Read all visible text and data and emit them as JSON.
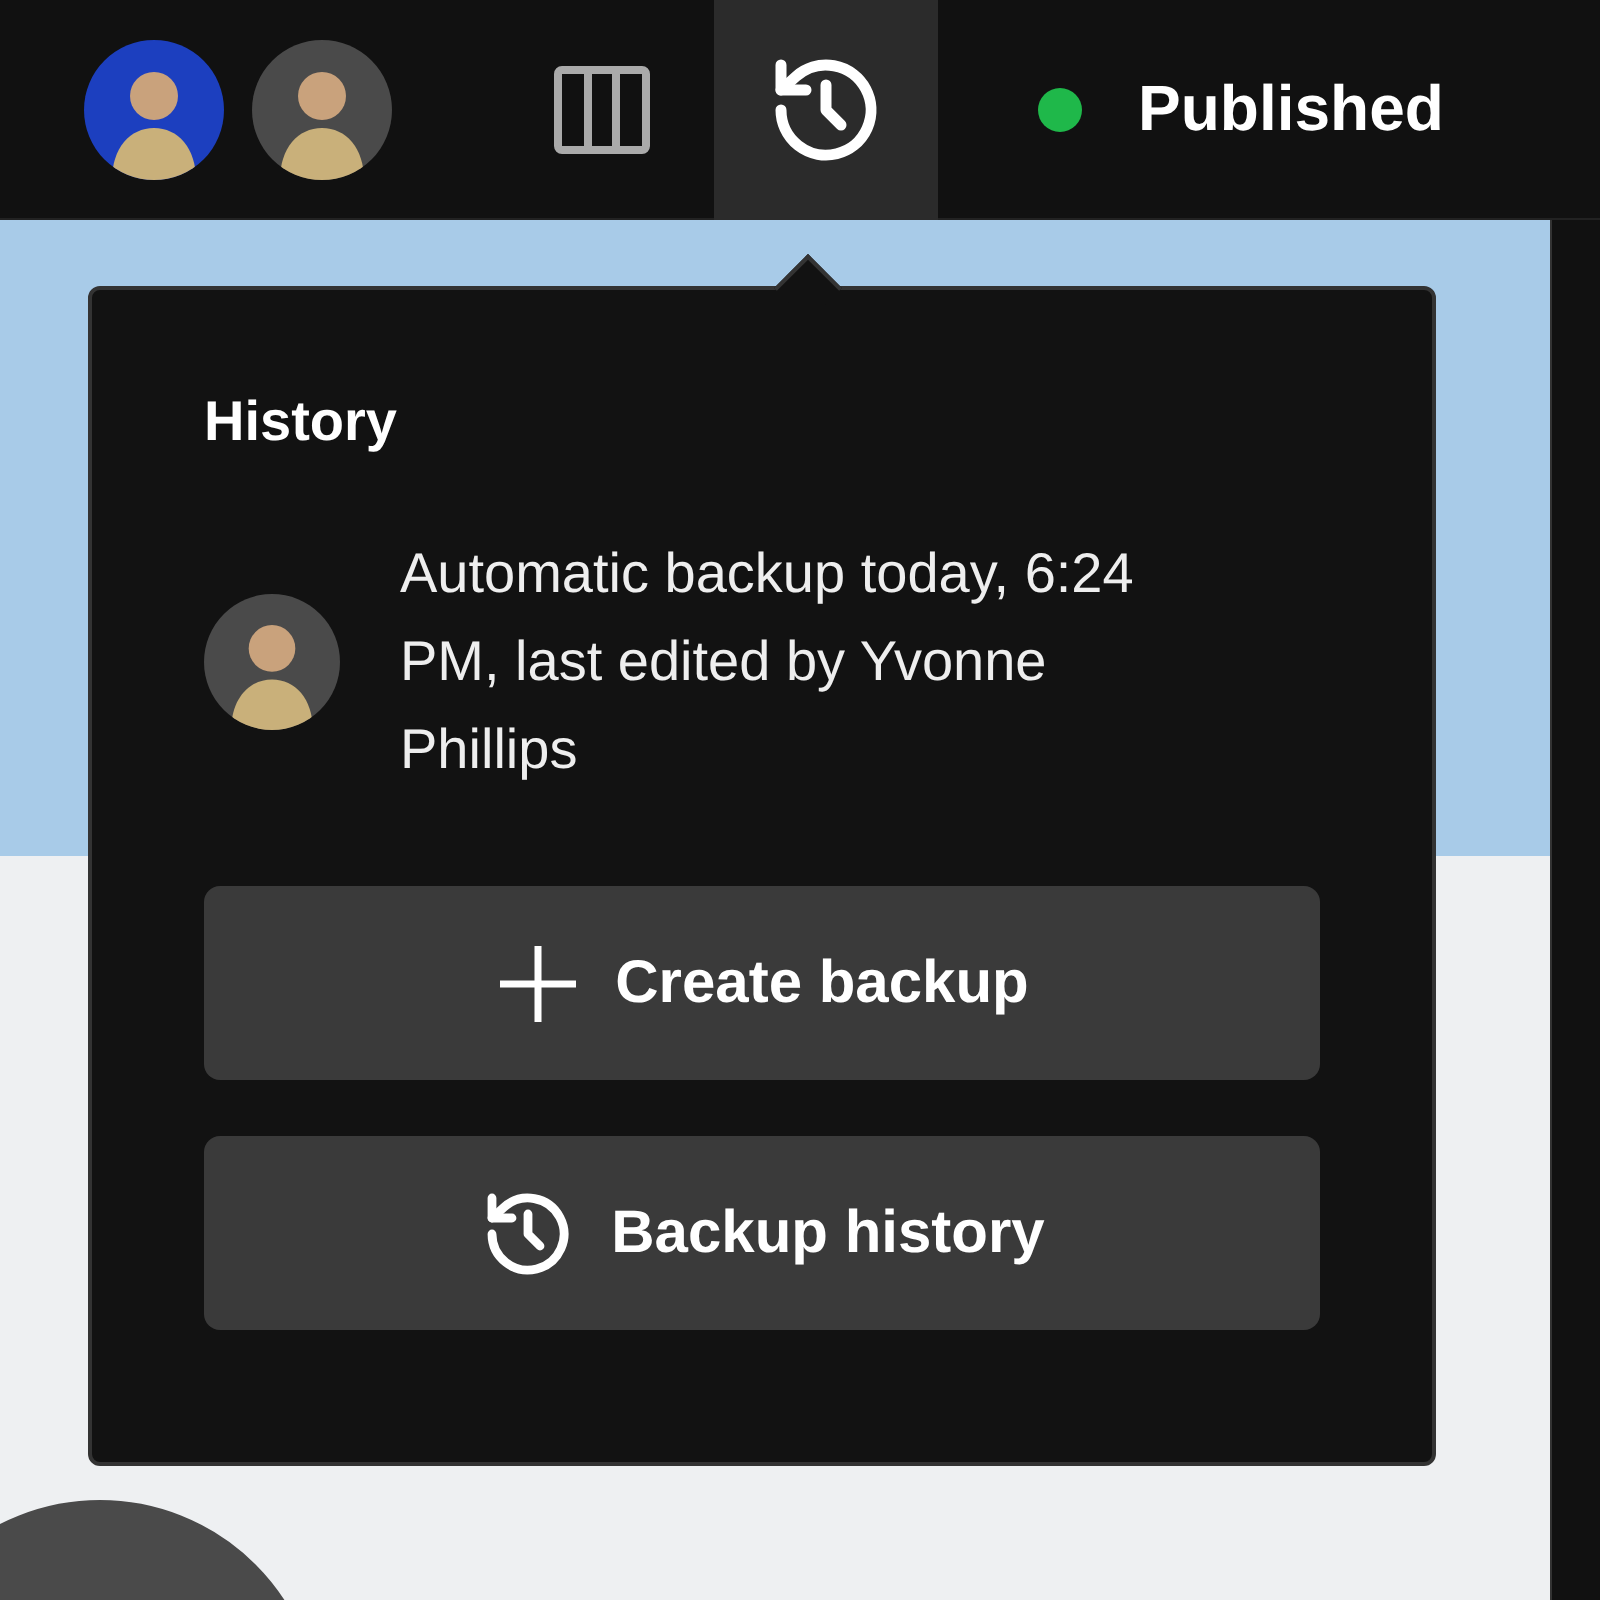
{
  "toolbar": {
    "avatars": [
      {
        "color": "#1c3fbf"
      },
      {
        "color": "#4a4a4a"
      }
    ],
    "tools": [
      {
        "kind": "columns",
        "selected": false
      },
      {
        "kind": "history",
        "selected": true
      }
    ],
    "status": {
      "label": "Published",
      "color": "#1fb84a"
    }
  },
  "history_popover": {
    "title": "History",
    "entry": {
      "text": "Automatic backup today, 6:24 PM, last edited by Yvonne Phillips"
    },
    "buttons": [
      {
        "kind": "create",
        "label": "Create backup"
      },
      {
        "kind": "history",
        "label": "Backup history"
      }
    ]
  }
}
